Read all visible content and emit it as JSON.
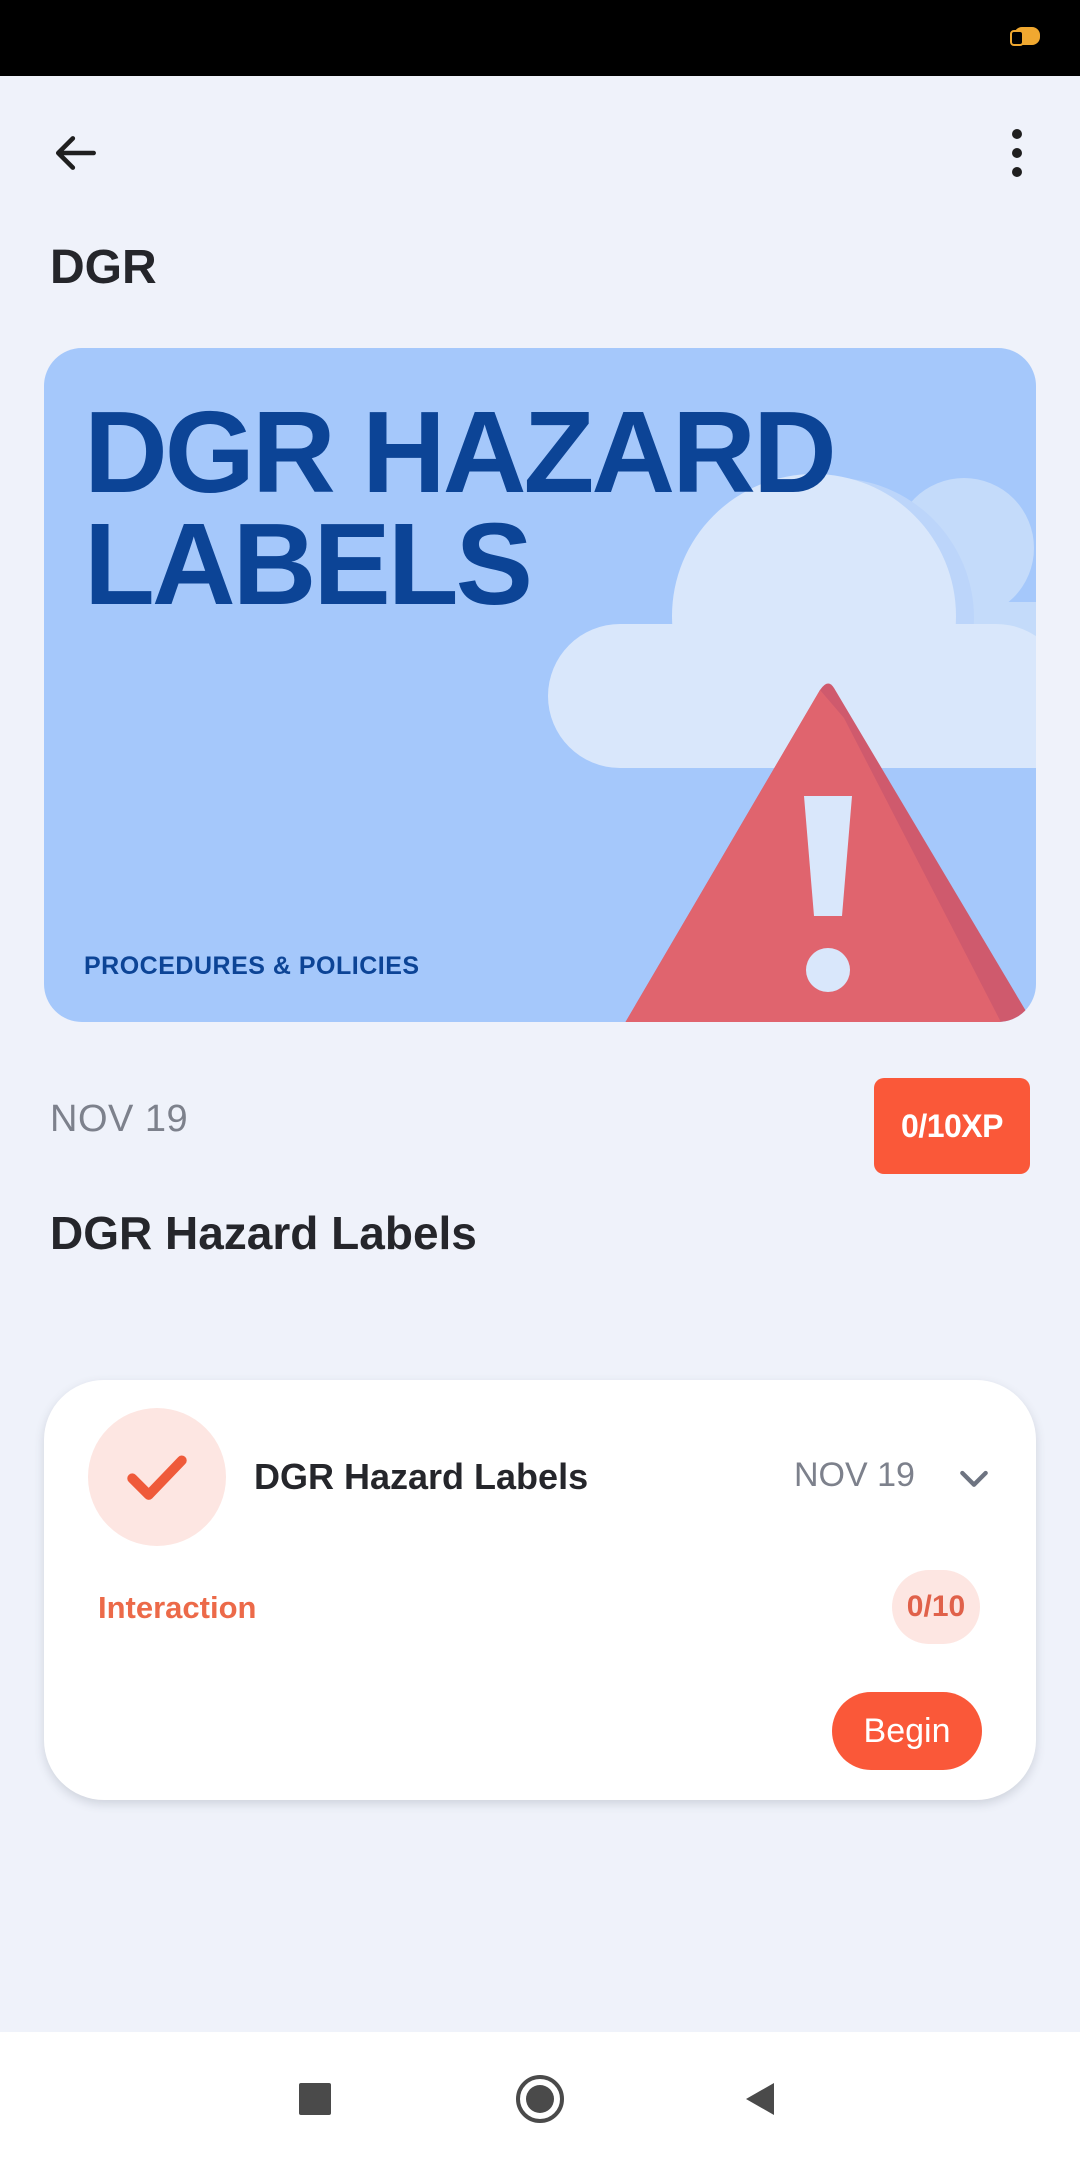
{
  "header": {
    "title": "DGR",
    "back_icon": "arrow-left-icon",
    "more_icon": "more-vert-icon"
  },
  "hero": {
    "title_line1": "DGR HAZARD",
    "title_line2": "LABELS",
    "subtitle": "PROCEDURES & POLICIES",
    "colors": {
      "background": "#a5c8fb",
      "text": "#0c4496",
      "warning": "#e0646e"
    }
  },
  "meta": {
    "date": "NOV 19",
    "xp": "0/10XP"
  },
  "content": {
    "title": "DGR Hazard Labels"
  },
  "activity": {
    "name": "DGR Hazard Labels",
    "date": "NOV 19",
    "type": "Interaction",
    "score": "0/10",
    "begin_label": "Begin",
    "status_icon": "check-icon",
    "expand_icon": "chevron-down-icon"
  },
  "colors": {
    "accent": "#fa5839",
    "accent_light": "#fde6e2",
    "background": "#eff2fa"
  }
}
